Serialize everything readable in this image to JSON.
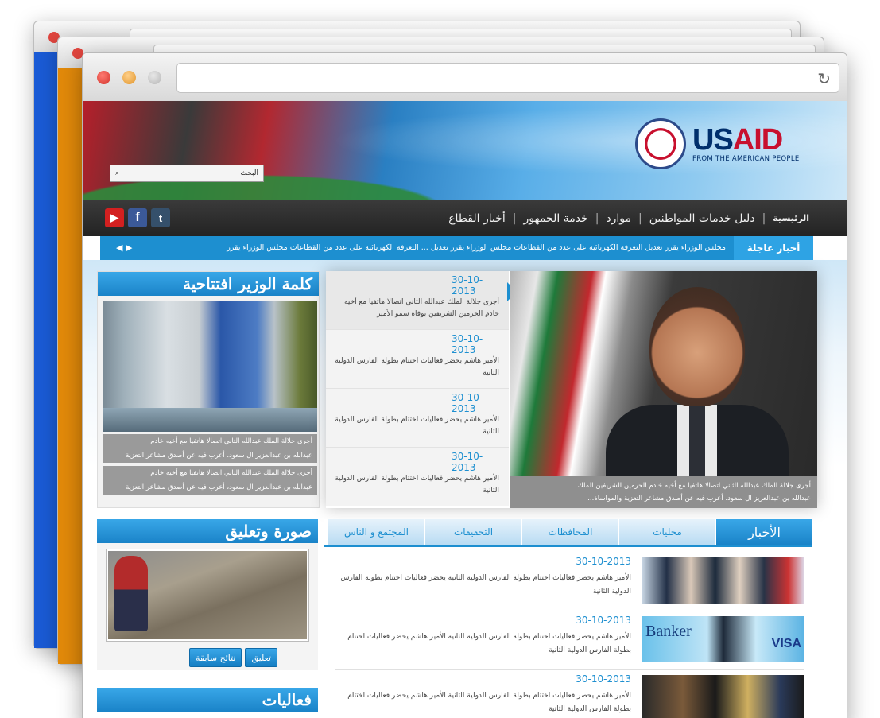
{
  "browser": {
    "reload_icon": "reload-icon"
  },
  "header": {
    "search_label": "البحث",
    "logo_name": "USAID",
    "logo_tagline": "FROM THE AMERICAN PEOPLE"
  },
  "nav": {
    "items": [
      {
        "label": "الرئيسية"
      },
      {
        "label": "دليل خدمات المواطنين"
      },
      {
        "label": "موارد"
      },
      {
        "label": "خدمة الجمهور"
      },
      {
        "label": "أخبار القطاع"
      }
    ],
    "social": [
      "youtube-icon",
      "facebook-icon",
      "tumblr-icon"
    ]
  },
  "ticker": {
    "label": "أخبار عاجلة",
    "text": "مجلس الوزراء يقرر تعديل التعرفة الكهربائية على عدد من القطاعات   مجلس الوزراء يقرر تعديل ...   التعرفة الكهربائية على عدد من القطاعات مجلس الوزراء يقرر",
    "arrows": "◀ ▶"
  },
  "minister": {
    "title": "كلمة الوزير افتتاحية",
    "lines": [
      "أجرى جلالة الملك عبدالله الثاني اتصالا هاتفيا مع أخيه خادم",
      "عبدالله بن عبدالعزيز ال سعود، أعرب فيه عن أصدق مشاعر التعزية",
      "أجرى جلالة الملك عبدالله الثاني اتصالا هاتفيا مع أخيه خادم",
      "عبدالله بن عبدالعزيز ال سعود، أعرب فيه عن أصدق مشاعر التعزية"
    ]
  },
  "slider": {
    "items": [
      {
        "date": "30-10-2013",
        "text": "أجرى جلالة الملك عبدالله الثاني اتصالا هاتفيا مع أخيه خادم الحرمين الشريفين بوفاة سمو الأمير"
      },
      {
        "date": "30-10-2013",
        "text": "الأمير هاشم يحضر فعاليات اختتام بطولة الفارس الدولية الثانية"
      },
      {
        "date": "30-10-2013",
        "text": "الأمير هاشم يحضر فعاليات اختتام بطولة الفارس الدولية الثانية"
      },
      {
        "date": "30-10-2013",
        "text": "الأمير هاشم يحضر فعاليات اختتام بطولة الفارس الدولية الثانية"
      }
    ],
    "caption_line1": "أجرى جلالة الملك عبدالله الثاني اتصالا هاتفيا مع أخيه خادم الحرمين الشريفين الملك",
    "caption_line2": "عبدالله بن عبدالعزيز ال سعود، أعرب فيه عن أصدق مشاعر التعزية والمواساة..."
  },
  "photo_comment": {
    "title": "صورة وتعليق",
    "comment_btn": "تعليق",
    "prev_results_btn": "نتائج سابقة"
  },
  "events": {
    "title": "فعاليات"
  },
  "news": {
    "tabs": [
      "الأخبار",
      "محليات",
      "المحافظات",
      "التحقيقات",
      "المجتمع و الناس"
    ],
    "items": [
      {
        "date": "30-10-2013",
        "text": "الأمير هاشم يحضر فعاليات اختتام بطولة الفارس الدولية الثانية يحضر فعاليات اختتام بطولة الفارس الدولية الثانية"
      },
      {
        "date": "30-10-2013",
        "text": "الأمير هاشم يحضر فعاليات اختتام بطولة الفارس الدولية الثانية الأمير هاشم يحضر فعاليات اختتام بطولة الفارس الدولية الثانية"
      },
      {
        "date": "30-10-2013",
        "text": "الأمير هاشم يحضر فعاليات اختتام بطولة الفارس الدولية الثانية الأمير هاشم يحضر فعاليات اختتام بطولة الفارس الدولية الثانية"
      }
    ],
    "thumb2_text": "Banker",
    "thumb2_visa": "VISA"
  },
  "colors": {
    "accent": "#1d8fd0",
    "nav_bg": "#2b2b2b",
    "brand_red": "#c8102e",
    "brand_navy": "#002f6c"
  }
}
